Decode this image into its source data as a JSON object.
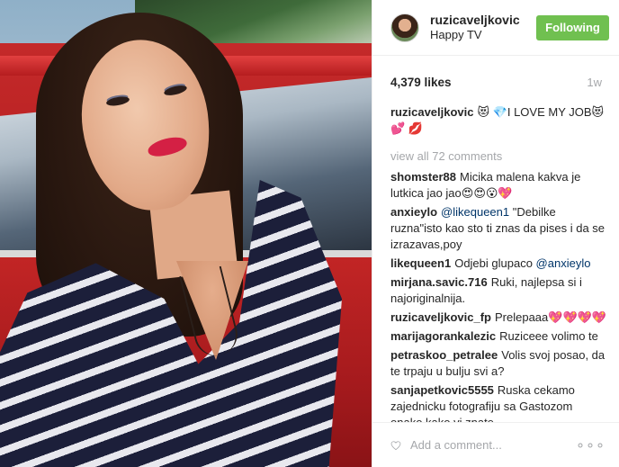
{
  "header": {
    "username": "ruzicaveljkovic",
    "location": "Happy TV",
    "follow_label": "Following"
  },
  "meta": {
    "likes": "4,379 likes",
    "age": "1w"
  },
  "caption": {
    "user": "ruzicaveljkovic",
    "text": "😻 💎I LOVE MY JOB😻 💕 💋"
  },
  "view_all_label": "view all 72 comments",
  "comments": [
    {
      "user": "shomster88",
      "text": "Micika malena kakva je lutkica jao jao😍😍😮💖"
    },
    {
      "user": "anxieylo",
      "mention": "@likequeen1",
      "text": " \"Debilke ruzna\"isto kao sto ti znas da pises i da se izrazavas,poy"
    },
    {
      "user": "likequeen1",
      "text": "Odjebi glupaco ",
      "mention_after": "@anxieylo"
    },
    {
      "user": "mirjana.savic.716",
      "text": "Ruki, najlepsa si i najoriginalnija."
    },
    {
      "user": "ruzicaveljkovic_fp",
      "text": "Prelepaaa💖💖💖💖"
    },
    {
      "user": "marijagorankalezic",
      "text": "Ruziceee volimo te"
    },
    {
      "user": "petraskoo_petralee",
      "text": "Volis svoj posao, da te trpaju u bulju svi a?"
    },
    {
      "user": "sanjapetkovic5555",
      "text": "Ruska cekamo zajednicku fotografiju sa Gastozom onako kako vi znate"
    }
  ],
  "add_comment": {
    "placeholder": "Add a comment...",
    "more_label": "∘∘∘"
  },
  "colors": {
    "follow_bg": "#70c050",
    "link": "#003569",
    "muted": "#a5a7aa"
  },
  "icons": {
    "like": "heart-outline-icon",
    "more": "more-options-icon"
  }
}
